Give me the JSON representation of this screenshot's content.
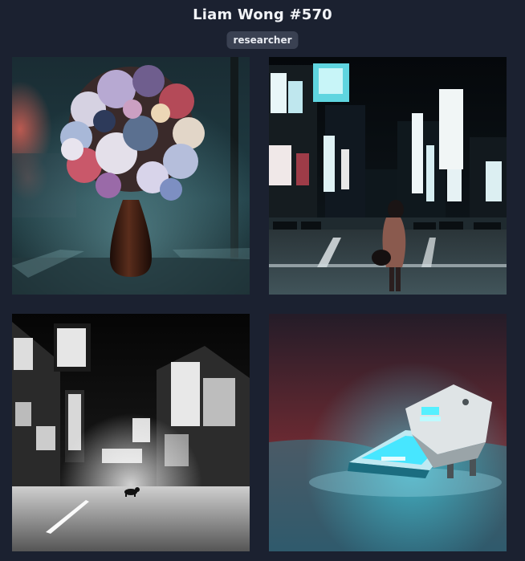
{
  "header": {
    "title": "Liam Wong #570",
    "badge": "researcher"
  },
  "gallery": {
    "images": [
      {
        "subject": "flower-vase-night-street"
      },
      {
        "subject": "neon-city-crosswalk-woman"
      },
      {
        "subject": "monochrome-night-street-dog"
      },
      {
        "subject": "glowing-hovercraft-desert"
      }
    ]
  },
  "colors": {
    "background": "#1b2130",
    "badge_bg": "#3a4152",
    "title": "#f2f4f8"
  }
}
